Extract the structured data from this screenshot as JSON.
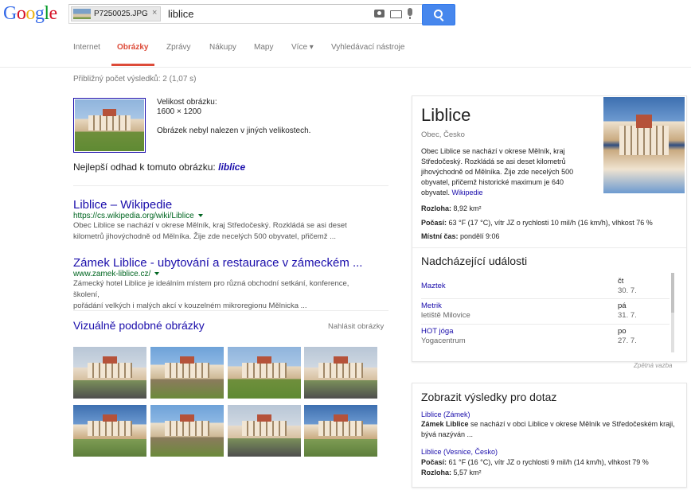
{
  "header": {
    "logo_letters": [
      {
        "ch": "G",
        "color": "#3369e8"
      },
      {
        "ch": "o",
        "color": "#d50f25"
      },
      {
        "ch": "o",
        "color": "#eeb211"
      },
      {
        "ch": "g",
        "color": "#3369e8"
      },
      {
        "ch": "l",
        "color": "#009925"
      },
      {
        "ch": "e",
        "color": "#d50f25"
      }
    ],
    "image_chip_name": "P7250025.JPG",
    "chip_close": "×",
    "query": "liblice"
  },
  "nav": {
    "items": [
      "Internet",
      "Obrázky",
      "Zprávy",
      "Nákupy",
      "Mapy",
      "Více ▾",
      "Vyhledávací nástroje"
    ],
    "active_index": 1
  },
  "stats": "Přibližný počet výsledků: 2 (1,07 s)",
  "query_image": {
    "size_label": "Velikost obrázku:",
    "size_value": "1600 × 1200",
    "not_found": "Obrázek nebyl nalezen v jiných velikostech."
  },
  "best_guess": {
    "prefix": "Nejlepší odhad k tomuto obrázku: ",
    "term": "liblice"
  },
  "results": [
    {
      "title": "Liblice – Wikipedie",
      "url": "https://cs.wikipedia.org/wiki/Liblice",
      "snippet_1": "Obec Liblice se nachází v okrese Mělník, kraj Středočeský. Rozkládá se asi deset",
      "snippet_2": "kilometrů jihovýchodně od Mělníka. Žije zde necelých 500 obyvatel, přičemž ..."
    },
    {
      "title": "Zámek Liblice - ubytování a restaurace v zámeckém ...",
      "url": "www.zamek-liblice.cz/",
      "snippet_1": "Zámecký hotel Liblice je ideálním místem pro různá obchodní setkání, konference, školení,",
      "snippet_2": "pořádání velkých i malých akcí v kouzelném mikroregionu Mělnicka ..."
    }
  ],
  "visually_similar": {
    "title": "Vizuálně podobné obrázky",
    "report": "Nahlásit obrázky"
  },
  "knowledge_panel": {
    "title": "Liblice",
    "subtitle": "Obec, Česko",
    "description": "Obec Liblice se nachází v okrese Mělník, kraj Středočeský. Rozkládá se asi deset kilometrů jihovýchodně od Mělníka. Žije zde necelých 500 obyvatel, přičemž historické maximum je 640 obyvatel. ",
    "description_link": "Wikipedie",
    "facts": [
      {
        "label": "Rozloha:",
        "value": " 8,92 km²"
      },
      {
        "label": "Počasí:",
        "value": " 63 °F (17 °C), vítr JZ o rychlosti 10 mil/h (16 km/h), vlhkost 76 %"
      },
      {
        "label": "Místní čas:",
        "value": " pondělí 9:06"
      }
    ],
    "events_heading": "Nadcházející události",
    "events": [
      {
        "name": "Maztek",
        "place": "",
        "day": "čt",
        "date": "30. 7."
      },
      {
        "name": "Metrik",
        "place": "letiště Milovice",
        "day": "pá",
        "date": "31. 7."
      },
      {
        "name": "HOT jóga",
        "place": "Yogacentrum",
        "day": "po",
        "date": "27. 7."
      }
    ]
  },
  "feedback": "Zpětná vazba",
  "show_results_for": {
    "heading": "Zobrazit výsledky pro dotaz",
    "items": [
      {
        "link": "Liblice (Zámek)",
        "bold": "Zámek Liblice",
        "text": " se nachází v obci Liblice v okrese Mělník ve Středočeském kraji, bývá nazýván ..."
      },
      {
        "link": "Liblice (Vesnice, Česko)",
        "lines": [
          {
            "label": "Počasí:",
            "value": " 61 °F (16 °C), vítr JZ o rychlosti 9 mil/h (14 km/h), vlhkost 79 %"
          },
          {
            "label": "Rozloha:",
            "value": " 5,57 km²"
          }
        ]
      }
    ]
  }
}
